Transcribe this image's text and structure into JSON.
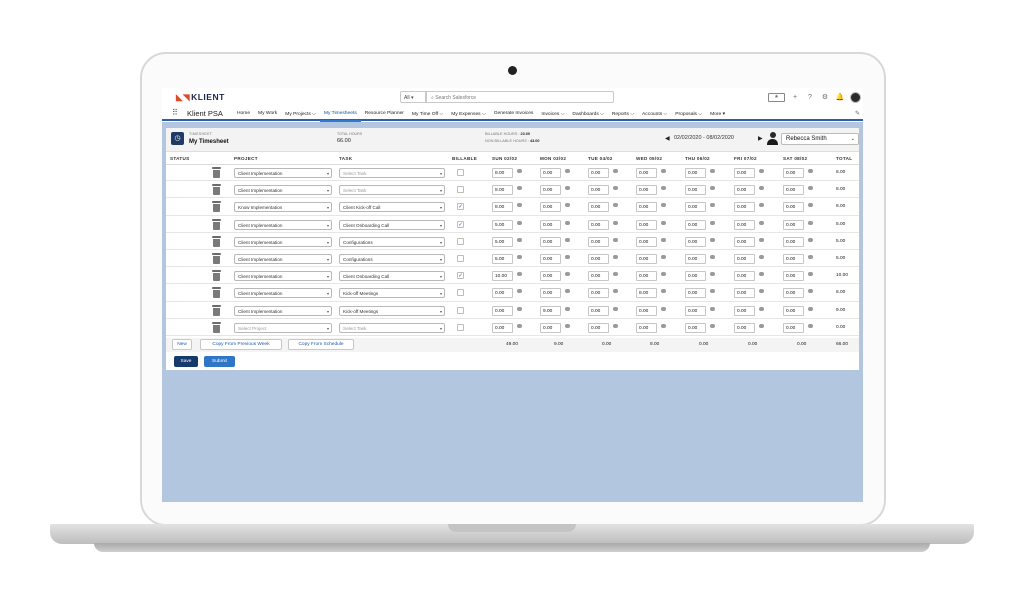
{
  "header": {
    "logo": "KLIENT",
    "search_scope": "All",
    "search_placeholder": "Search Salesforce",
    "tools": [
      "★",
      "+",
      "?",
      "⚙",
      "🔔"
    ]
  },
  "nav": {
    "app_name": "Klient PSA",
    "items": [
      {
        "label": "Home",
        "active": false
      },
      {
        "label": "My Work",
        "active": false
      },
      {
        "label": "My Projects ⌵",
        "active": false
      },
      {
        "label": "My Timesheets",
        "active": true
      },
      {
        "label": "Resource Planner",
        "active": false
      },
      {
        "label": "My Time Off ⌵",
        "active": false
      },
      {
        "label": "My Expenses ⌵",
        "active": false
      },
      {
        "label": "Generate Invoices",
        "active": false
      },
      {
        "label": "Invoices ⌵",
        "active": false
      },
      {
        "label": "Dashboards ⌵",
        "active": false
      },
      {
        "label": "Reports ⌵",
        "active": false
      },
      {
        "label": "Accounts ⌵",
        "active": false
      },
      {
        "label": "Proposals ⌵",
        "active": false
      },
      {
        "label": "More ▾",
        "active": false
      }
    ]
  },
  "timesheet": {
    "label": "TIMESHEET",
    "title": "My Timesheet",
    "total_hours_label": "TOTAL HOURS",
    "total_hours": "66.00",
    "billable_label": "BILLABLE HOURS :",
    "billable_value": "23.00",
    "non_billable_label": "NON BILLABLE HOURS :",
    "non_billable_value": "43.00",
    "date_range": "02/02/2020 - 08/02/2020",
    "user": "Rebecca Smith"
  },
  "table": {
    "columns": [
      "STATUS",
      "PROJECT",
      "TASK",
      "BILLABLE",
      "SUN 02/02",
      "MON 03/02",
      "TUE 04/02",
      "WED 05/02",
      "THU 06/02",
      "FRI 07/02",
      "SAT 08/02",
      "TOTAL"
    ],
    "rows": [
      {
        "project": "Client Implementation",
        "task": "Select Task",
        "billable": false,
        "hours": [
          "8.00",
          "0.00",
          "0.00",
          "0.00",
          "0.00",
          "0.00",
          "0.00"
        ],
        "total": "8.00"
      },
      {
        "project": "Client Implementation",
        "task": "Select Task",
        "billable": false,
        "hours": [
          "8.00",
          "0.00",
          "0.00",
          "0.00",
          "0.00",
          "0.00",
          "0.00"
        ],
        "total": "8.00"
      },
      {
        "project": "Know Implementation",
        "task": "Client Kick-off Call",
        "billable": true,
        "hours": [
          "8.00",
          "0.00",
          "0.00",
          "0.00",
          "0.00",
          "0.00",
          "0.00"
        ],
        "total": "8.00"
      },
      {
        "project": "Client Implementation",
        "task": "Client Onboarding Call",
        "billable": true,
        "hours": [
          "5.00",
          "0.00",
          "0.00",
          "0.00",
          "0.00",
          "0.00",
          "0.00"
        ],
        "total": "5.00"
      },
      {
        "project": "Client Implementation",
        "task": "Configurations",
        "billable": false,
        "hours": [
          "5.00",
          "0.00",
          "0.00",
          "0.00",
          "0.00",
          "0.00",
          "0.00"
        ],
        "total": "5.00"
      },
      {
        "project": "Client Implementation",
        "task": "Configurations",
        "billable": false,
        "hours": [
          "5.00",
          "0.00",
          "0.00",
          "0.00",
          "0.00",
          "0.00",
          "0.00"
        ],
        "total": "5.00"
      },
      {
        "project": "Client Implementation",
        "task": "Client Onboarding Call",
        "billable": true,
        "hours": [
          "10.00",
          "0.00",
          "0.00",
          "0.00",
          "0.00",
          "0.00",
          "0.00"
        ],
        "total": "10.00"
      },
      {
        "project": "Client Implementation",
        "task": "Kick-off Meetings",
        "billable": false,
        "hours": [
          "0.00",
          "0.00",
          "0.00",
          "8.00",
          "0.00",
          "0.00",
          "0.00"
        ],
        "total": "8.00"
      },
      {
        "project": "Client Implementation",
        "task": "Kick-off Meetings",
        "billable": false,
        "hours": [
          "0.00",
          "9.00",
          "0.00",
          "0.00",
          "0.00",
          "0.00",
          "0.00"
        ],
        "total": "9.00"
      },
      {
        "project": "Select Project",
        "task": "Select Task",
        "billable": false,
        "placeholder": true,
        "hours": [
          "0.00",
          "0.00",
          "0.00",
          "0.00",
          "0.00",
          "0.00",
          "0.00"
        ],
        "total": "0.00"
      }
    ],
    "footer_sums": [
      "49.00",
      "9.00",
      "0.00",
      "8.00",
      "0.00",
      "0.00",
      "0.00",
      "66.00"
    ]
  },
  "actions": {
    "new": "New",
    "copy_previous": "Copy From Previous Week",
    "copy_schedule": "Copy From Schedule",
    "save": "Save",
    "submit": "Submit"
  }
}
